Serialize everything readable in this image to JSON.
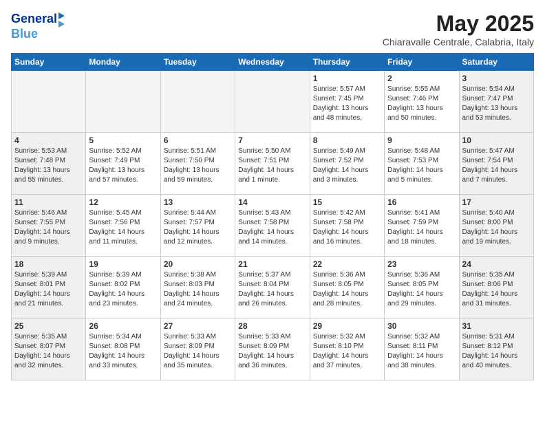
{
  "header": {
    "logo_line1": "General",
    "logo_line2": "Blue",
    "month_title": "May 2025",
    "location": "Chiaravalle Centrale, Calabria, Italy"
  },
  "weekdays": [
    "Sunday",
    "Monday",
    "Tuesday",
    "Wednesday",
    "Thursday",
    "Friday",
    "Saturday"
  ],
  "weeks": [
    [
      {
        "day": "",
        "empty": true
      },
      {
        "day": "",
        "empty": true
      },
      {
        "day": "",
        "empty": true
      },
      {
        "day": "",
        "empty": true
      },
      {
        "day": "1",
        "sunrise": "5:57 AM",
        "sunset": "7:45 PM",
        "daylight": "13 hours and 48 minutes."
      },
      {
        "day": "2",
        "sunrise": "5:55 AM",
        "sunset": "7:46 PM",
        "daylight": "13 hours and 50 minutes."
      },
      {
        "day": "3",
        "sunrise": "5:54 AM",
        "sunset": "7:47 PM",
        "daylight": "13 hours and 53 minutes."
      }
    ],
    [
      {
        "day": "4",
        "sunrise": "5:53 AM",
        "sunset": "7:48 PM",
        "daylight": "13 hours and 55 minutes."
      },
      {
        "day": "5",
        "sunrise": "5:52 AM",
        "sunset": "7:49 PM",
        "daylight": "13 hours and 57 minutes."
      },
      {
        "day": "6",
        "sunrise": "5:51 AM",
        "sunset": "7:50 PM",
        "daylight": "13 hours and 59 minutes."
      },
      {
        "day": "7",
        "sunrise": "5:50 AM",
        "sunset": "7:51 PM",
        "daylight": "14 hours and 1 minute."
      },
      {
        "day": "8",
        "sunrise": "5:49 AM",
        "sunset": "7:52 PM",
        "daylight": "14 hours and 3 minutes."
      },
      {
        "day": "9",
        "sunrise": "5:48 AM",
        "sunset": "7:53 PM",
        "daylight": "14 hours and 5 minutes."
      },
      {
        "day": "10",
        "sunrise": "5:47 AM",
        "sunset": "7:54 PM",
        "daylight": "14 hours and 7 minutes."
      }
    ],
    [
      {
        "day": "11",
        "sunrise": "5:46 AM",
        "sunset": "7:55 PM",
        "daylight": "14 hours and 9 minutes."
      },
      {
        "day": "12",
        "sunrise": "5:45 AM",
        "sunset": "7:56 PM",
        "daylight": "14 hours and 11 minutes."
      },
      {
        "day": "13",
        "sunrise": "5:44 AM",
        "sunset": "7:57 PM",
        "daylight": "14 hours and 12 minutes."
      },
      {
        "day": "14",
        "sunrise": "5:43 AM",
        "sunset": "7:58 PM",
        "daylight": "14 hours and 14 minutes."
      },
      {
        "day": "15",
        "sunrise": "5:42 AM",
        "sunset": "7:58 PM",
        "daylight": "14 hours and 16 minutes."
      },
      {
        "day": "16",
        "sunrise": "5:41 AM",
        "sunset": "7:59 PM",
        "daylight": "14 hours and 18 minutes."
      },
      {
        "day": "17",
        "sunrise": "5:40 AM",
        "sunset": "8:00 PM",
        "daylight": "14 hours and 19 minutes."
      }
    ],
    [
      {
        "day": "18",
        "sunrise": "5:39 AM",
        "sunset": "8:01 PM",
        "daylight": "14 hours and 21 minutes."
      },
      {
        "day": "19",
        "sunrise": "5:39 AM",
        "sunset": "8:02 PM",
        "daylight": "14 hours and 23 minutes."
      },
      {
        "day": "20",
        "sunrise": "5:38 AM",
        "sunset": "8:03 PM",
        "daylight": "14 hours and 24 minutes."
      },
      {
        "day": "21",
        "sunrise": "5:37 AM",
        "sunset": "8:04 PM",
        "daylight": "14 hours and 26 minutes."
      },
      {
        "day": "22",
        "sunrise": "5:36 AM",
        "sunset": "8:05 PM",
        "daylight": "14 hours and 28 minutes."
      },
      {
        "day": "23",
        "sunrise": "5:36 AM",
        "sunset": "8:05 PM",
        "daylight": "14 hours and 29 minutes."
      },
      {
        "day": "24",
        "sunrise": "5:35 AM",
        "sunset": "8:06 PM",
        "daylight": "14 hours and 31 minutes."
      }
    ],
    [
      {
        "day": "25",
        "sunrise": "5:35 AM",
        "sunset": "8:07 PM",
        "daylight": "14 hours and 32 minutes."
      },
      {
        "day": "26",
        "sunrise": "5:34 AM",
        "sunset": "8:08 PM",
        "daylight": "14 hours and 33 minutes."
      },
      {
        "day": "27",
        "sunrise": "5:33 AM",
        "sunset": "8:09 PM",
        "daylight": "14 hours and 35 minutes."
      },
      {
        "day": "28",
        "sunrise": "5:33 AM",
        "sunset": "8:09 PM",
        "daylight": "14 hours and 36 minutes."
      },
      {
        "day": "29",
        "sunrise": "5:32 AM",
        "sunset": "8:10 PM",
        "daylight": "14 hours and 37 minutes."
      },
      {
        "day": "30",
        "sunrise": "5:32 AM",
        "sunset": "8:11 PM",
        "daylight": "14 hours and 38 minutes."
      },
      {
        "day": "31",
        "sunrise": "5:31 AM",
        "sunset": "8:12 PM",
        "daylight": "14 hours and 40 minutes."
      }
    ]
  ]
}
